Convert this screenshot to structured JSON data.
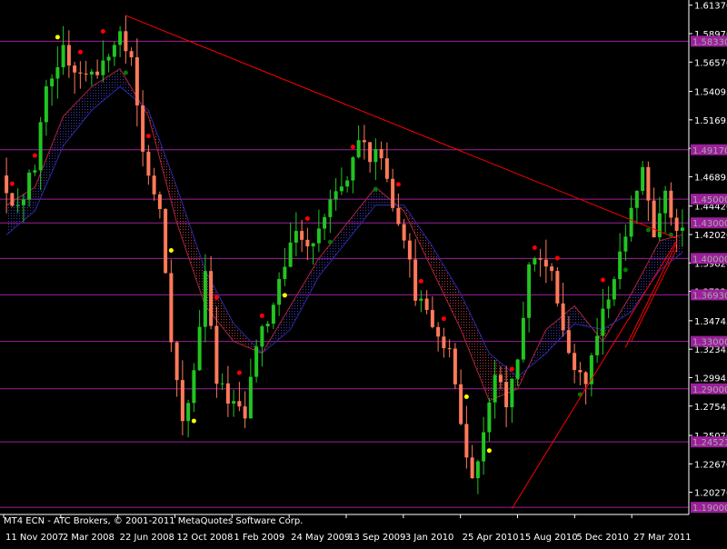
{
  "caption": "MT4 ECN - ATC Brokers, © 2001-2011 MetaQuotes Software Corp.",
  "chart_data": {
    "type": "candlestick",
    "instrument": "",
    "timeframe": "",
    "colors": {
      "background": "#000000",
      "bull": "#22c422",
      "bear": "#ff7a5a",
      "axis": "#ffffff",
      "hline": "#9b1f9b",
      "trendline": "#ff0000",
      "ma1": "#b0243a",
      "ma2": "#2a2aa8",
      "cloud_bull": "#3a3ab8",
      "cloud_bear": "#b03a3a",
      "dot_red": "#ff0000",
      "dot_green": "#007a00",
      "dot_yellow": "#ffff00",
      "tag_bg": "#9b1f9b",
      "tag_text": "#a8a8a8"
    },
    "ylim": [
      1.184,
      1.615
    ],
    "y_ticks": [
      "1.61370",
      "1.58970",
      "1.56570",
      "1.54095",
      "1.51695",
      "1.49295",
      "1.46895",
      "1.44420",
      "1.42020",
      "1.39620",
      "1.37220",
      "1.34745",
      "1.32345",
      "1.29945",
      "1.27545",
      "1.25070",
      "1.22670",
      "1.20270"
    ],
    "x_labels": [
      "11 Nov 2007",
      "2 Mar 2008",
      "22 Jun 2008",
      "12 Oct 2008",
      "1 Feb 2009",
      "24 May 2009",
      "13 Sep 2009",
      "3 Jan 2010",
      "25 Apr 2010",
      "15 Aug 2010",
      "5 Dec 2010",
      "27 Mar 2011"
    ],
    "horizontal_levels": [
      {
        "price": 1.5833,
        "label": "1.58330"
      },
      {
        "price": 1.4917,
        "label": "1.49170"
      },
      {
        "price": 1.45,
        "label": "1.45000"
      },
      {
        "price": 1.43,
        "label": "1.43000"
      },
      {
        "price": 1.4,
        "label": "1.40000"
      },
      {
        "price": 1.3693,
        "label": "1.36930"
      },
      {
        "price": 1.33,
        "label": "1.33000"
      },
      {
        "price": 1.29,
        "label": "1.29000"
      },
      {
        "price": 1.24521,
        "label": "1.24521"
      },
      {
        "price": 1.19,
        "label": "1.19000"
      }
    ],
    "trendlines": [
      {
        "x1": 21,
        "y1": 1.605,
        "x2": 118,
        "y2": 1.417
      },
      {
        "x1": 89,
        "y1": 1.189,
        "x2": 118,
        "y2": 1.415
      },
      {
        "x1": 109,
        "y1": 1.325,
        "x2": 118,
        "y2": 1.413
      },
      {
        "x1": 110,
        "y1": 1.33,
        "x2": 118,
        "y2": 1.408
      }
    ],
    "price_path": [
      {
        "i": 0,
        "p": 1.47
      },
      {
        "i": 3,
        "p": 1.44
      },
      {
        "i": 6,
        "p": 1.48
      },
      {
        "i": 8,
        "p": 1.54
      },
      {
        "i": 11,
        "p": 1.575
      },
      {
        "i": 13,
        "p": 1.56
      },
      {
        "i": 16,
        "p": 1.555
      },
      {
        "i": 18,
        "p": 1.565
      },
      {
        "i": 21,
        "p": 1.595
      },
      {
        "i": 23,
        "p": 1.565
      },
      {
        "i": 25,
        "p": 1.49
      },
      {
        "i": 28,
        "p": 1.44
      },
      {
        "i": 30,
        "p": 1.33
      },
      {
        "i": 32,
        "p": 1.26
      },
      {
        "i": 34,
        "p": 1.3
      },
      {
        "i": 36,
        "p": 1.39
      },
      {
        "i": 38,
        "p": 1.3
      },
      {
        "i": 40,
        "p": 1.28
      },
      {
        "i": 43,
        "p": 1.265
      },
      {
        "i": 45,
        "p": 1.33
      },
      {
        "i": 47,
        "p": 1.35
      },
      {
        "i": 50,
        "p": 1.395
      },
      {
        "i": 52,
        "p": 1.42
      },
      {
        "i": 55,
        "p": 1.41
      },
      {
        "i": 58,
        "p": 1.445
      },
      {
        "i": 61,
        "p": 1.465
      },
      {
        "i": 63,
        "p": 1.5
      },
      {
        "i": 65,
        "p": 1.485
      },
      {
        "i": 67,
        "p": 1.49
      },
      {
        "i": 69,
        "p": 1.44
      },
      {
        "i": 71,
        "p": 1.42
      },
      {
        "i": 73,
        "p": 1.37
      },
      {
        "i": 75,
        "p": 1.355
      },
      {
        "i": 77,
        "p": 1.34
      },
      {
        "i": 79,
        "p": 1.32
      },
      {
        "i": 81,
        "p": 1.26
      },
      {
        "i": 83,
        "p": 1.215
      },
      {
        "i": 85,
        "p": 1.25
      },
      {
        "i": 87,
        "p": 1.305
      },
      {
        "i": 89,
        "p": 1.275
      },
      {
        "i": 91,
        "p": 1.31
      },
      {
        "i": 93,
        "p": 1.39
      },
      {
        "i": 95,
        "p": 1.4
      },
      {
        "i": 97,
        "p": 1.385
      },
      {
        "i": 99,
        "p": 1.335
      },
      {
        "i": 101,
        "p": 1.31
      },
      {
        "i": 103,
        "p": 1.295
      },
      {
        "i": 105,
        "p": 1.34
      },
      {
        "i": 107,
        "p": 1.37
      },
      {
        "i": 109,
        "p": 1.4
      },
      {
        "i": 111,
        "p": 1.445
      },
      {
        "i": 113,
        "p": 1.475
      },
      {
        "i": 115,
        "p": 1.42
      },
      {
        "i": 117,
        "p": 1.455
      },
      {
        "i": 119,
        "p": 1.425
      }
    ],
    "ma_fast": [
      {
        "i": 0,
        "p": 1.445
      },
      {
        "i": 5,
        "p": 1.46
      },
      {
        "i": 10,
        "p": 1.52
      },
      {
        "i": 15,
        "p": 1.545
      },
      {
        "i": 20,
        "p": 1.56
      },
      {
        "i": 25,
        "p": 1.52
      },
      {
        "i": 30,
        "p": 1.43
      },
      {
        "i": 35,
        "p": 1.36
      },
      {
        "i": 40,
        "p": 1.33
      },
      {
        "i": 45,
        "p": 1.32
      },
      {
        "i": 50,
        "p": 1.36
      },
      {
        "i": 55,
        "p": 1.4
      },
      {
        "i": 60,
        "p": 1.43
      },
      {
        "i": 65,
        "p": 1.46
      },
      {
        "i": 70,
        "p": 1.44
      },
      {
        "i": 75,
        "p": 1.39
      },
      {
        "i": 80,
        "p": 1.34
      },
      {
        "i": 85,
        "p": 1.28
      },
      {
        "i": 90,
        "p": 1.29
      },
      {
        "i": 95,
        "p": 1.34
      },
      {
        "i": 100,
        "p": 1.36
      },
      {
        "i": 105,
        "p": 1.33
      },
      {
        "i": 110,
        "p": 1.37
      },
      {
        "i": 115,
        "p": 1.415
      },
      {
        "i": 119,
        "p": 1.42
      }
    ],
    "ma_slow": [
      {
        "i": 0,
        "p": 1.42
      },
      {
        "i": 5,
        "p": 1.44
      },
      {
        "i": 10,
        "p": 1.495
      },
      {
        "i": 15,
        "p": 1.525
      },
      {
        "i": 20,
        "p": 1.545
      },
      {
        "i": 25,
        "p": 1.525
      },
      {
        "i": 30,
        "p": 1.46
      },
      {
        "i": 35,
        "p": 1.39
      },
      {
        "i": 40,
        "p": 1.345
      },
      {
        "i": 45,
        "p": 1.32
      },
      {
        "i": 50,
        "p": 1.34
      },
      {
        "i": 55,
        "p": 1.385
      },
      {
        "i": 60,
        "p": 1.415
      },
      {
        "i": 65,
        "p": 1.445
      },
      {
        "i": 70,
        "p": 1.445
      },
      {
        "i": 75,
        "p": 1.41
      },
      {
        "i": 80,
        "p": 1.37
      },
      {
        "i": 85,
        "p": 1.32
      },
      {
        "i": 90,
        "p": 1.3
      },
      {
        "i": 95,
        "p": 1.32
      },
      {
        "i": 100,
        "p": 1.345
      },
      {
        "i": 105,
        "p": 1.34
      },
      {
        "i": 110,
        "p": 1.355
      },
      {
        "i": 115,
        "p": 1.39
      },
      {
        "i": 119,
        "p": 1.405
      }
    ],
    "n_bars": 120
  }
}
